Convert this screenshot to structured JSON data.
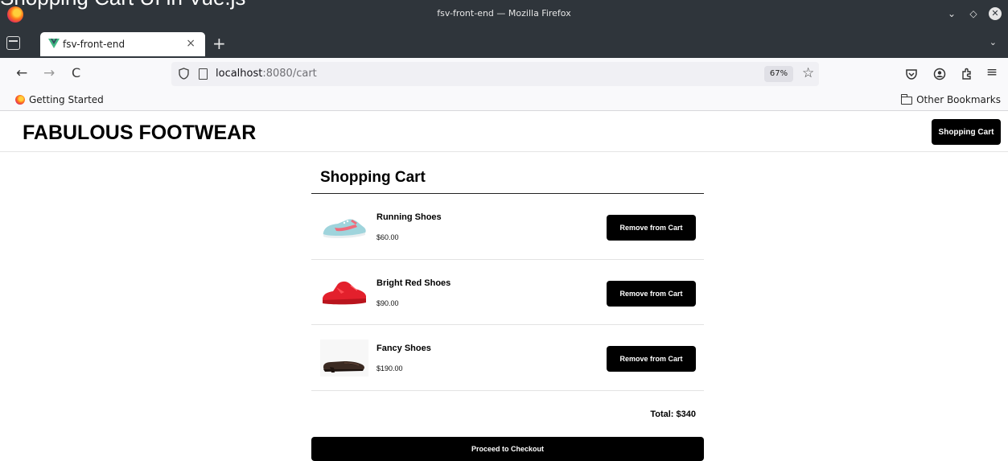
{
  "overlay_caption": "Shopping Cart UI in Vue.js",
  "browser": {
    "window_title": "fsv-front-end — Mozilla Firefox",
    "tab": {
      "label": "fsv-front-end",
      "close": "×"
    },
    "new_tab": "+",
    "url": {
      "host": "localhost",
      "path": ":8080/cart"
    },
    "zoom": "67%",
    "bookmarks": {
      "getting_started": "Getting Started",
      "other": "Other Bookmarks"
    },
    "glyphs": {
      "back": "←",
      "forward": "→",
      "reload": "C",
      "star": "☆",
      "menu": "≡",
      "chevron": "⌄",
      "minimize": "⌄",
      "restore": "◇",
      "close": "✕"
    }
  },
  "site": {
    "title": "FABULOUS FOOTWEAR",
    "header_button": "Shopping Cart"
  },
  "cart": {
    "heading": "Shopping Cart",
    "items": [
      {
        "name": "Running Shoes",
        "price": "$60.00",
        "image": "running-shoe",
        "remove_label": "Remove from Cart"
      },
      {
        "name": "Bright Red Shoes",
        "price": "$90.00",
        "image": "red-shoe",
        "remove_label": "Remove from Cart"
      },
      {
        "name": "Fancy Shoes",
        "price": "$190.00",
        "image": "dress-shoe",
        "remove_label": "Remove from Cart"
      }
    ],
    "total": "Total: $340",
    "checkout_label": "Proceed to Checkout"
  },
  "colors": {
    "chrome_dark": "#2f353b",
    "button_bg": "#000000",
    "button_text": "#ffffff"
  }
}
